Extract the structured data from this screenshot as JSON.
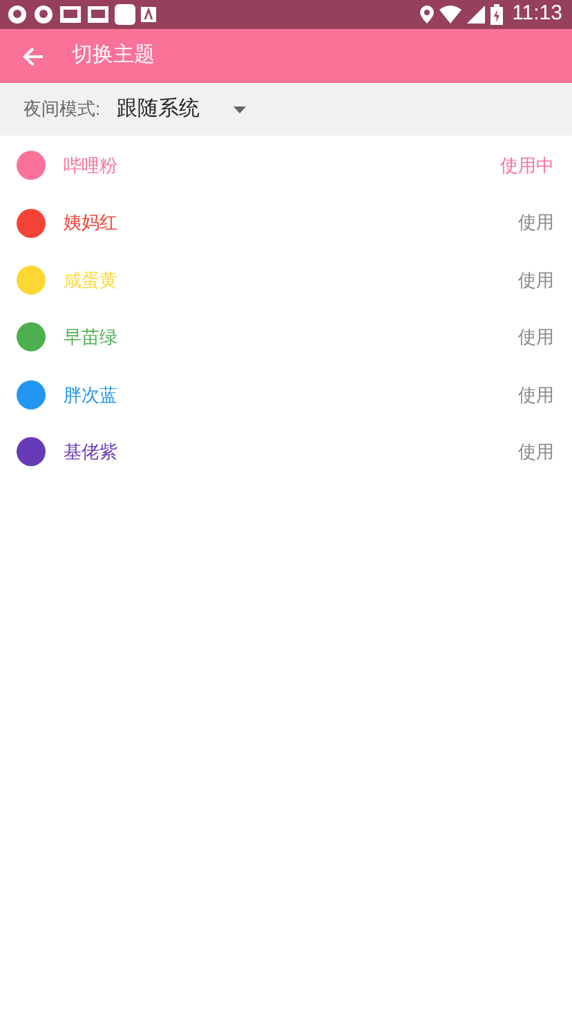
{
  "status_bar": {
    "time": "11:13"
  },
  "app_bar": {
    "title": "切换主题"
  },
  "night_mode": {
    "label": "夜间模式:",
    "value": "跟随系统"
  },
  "themes": [
    {
      "name": "哔哩粉",
      "color": "#fb7299",
      "action": "使用中",
      "selected": true
    },
    {
      "name": "姨妈红",
      "color": "#f44336",
      "action": "使用",
      "selected": false
    },
    {
      "name": "咸蛋黄",
      "color": "#fdd835",
      "action": "使用",
      "selected": false
    },
    {
      "name": "早苗绿",
      "color": "#4caf50",
      "action": "使用",
      "selected": false
    },
    {
      "name": "胖次蓝",
      "color": "#2196f3",
      "action": "使用",
      "selected": false
    },
    {
      "name": "基佬紫",
      "color": "#673ab7",
      "action": "使用",
      "selected": false
    }
  ]
}
